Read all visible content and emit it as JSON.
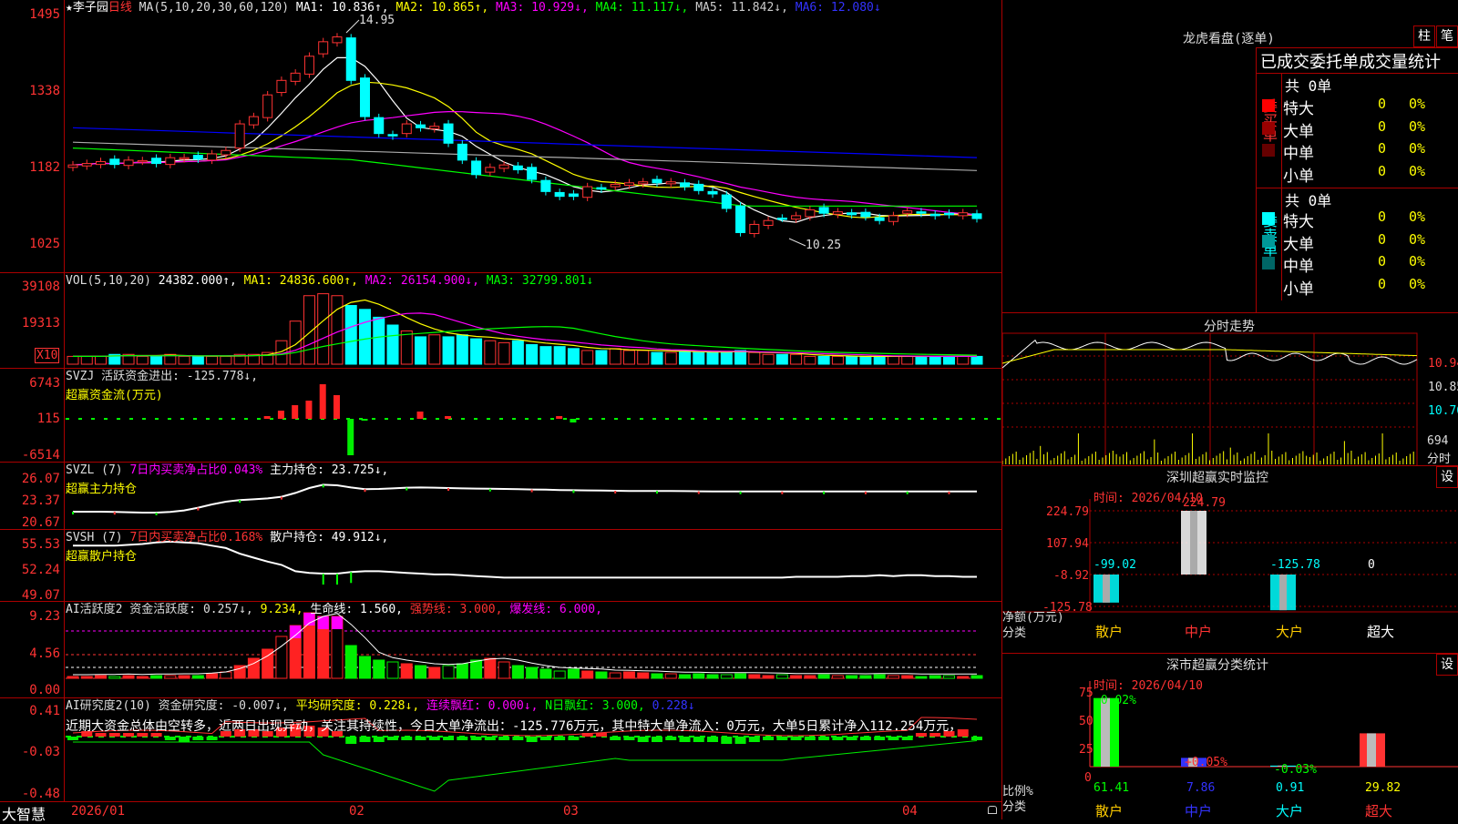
{
  "main": {
    "stock_name": "★李子园",
    "period": "日线",
    "ma_label": "MA(5,10,20,30,60,120)",
    "ma1": "MA1: 10.836↑,",
    "ma2": "MA2: 10.865↑,",
    "ma3": "MA3: 10.929↓,",
    "ma4": "MA4: 11.117↓,",
    "ma5": "MA5: 11.842↓,",
    "ma6": "MA6: 12.080↓",
    "y_ticks": [
      "1495",
      "1338",
      "1182",
      "1025"
    ],
    "high_label": "14.95",
    "low_label": "10.25",
    "colors": {
      "ma1": "#ffffff",
      "ma2": "#ffff00",
      "ma3": "#ff00ff",
      "ma4": "#00ff00",
      "ma5": "#9999ff",
      "ma6": "#0000ff",
      "up": "#ff3333",
      "down": "#00ffff"
    }
  },
  "vol": {
    "label": "VOL(5,10,20)",
    "value": "24382.000↑,",
    "ma1": "MA1: 24836.600↑,",
    "ma2": "MA2: 26154.900↓,",
    "ma3": "MA3: 32799.801↓",
    "y_ticks": [
      "39108",
      "19313"
    ],
    "unit": "X10"
  },
  "svzj": {
    "label": "SVZJ  活跃资金进出: -125.778↓,",
    "sub": "超赢资金流(万元)",
    "y_ticks": [
      "6743",
      "115",
      "-6514"
    ]
  },
  "svzl": {
    "label_a": "SVZL (7)",
    "label_b": "7日内买卖净占比0.043%",
    "label_c": "主力持仓: 23.725↓,",
    "sub": "超赢主力持仓",
    "y_ticks": [
      "26.07",
      "23.37",
      "20.67"
    ]
  },
  "svsh": {
    "label_a": "SVSH (7)",
    "label_b": "7日内买卖净占比0.168%",
    "label_c": "散户持仓: 49.912↓,",
    "sub": "超赢散户持仓",
    "y_ticks": [
      "55.53",
      "52.24",
      "49.07"
    ]
  },
  "ai2": {
    "label_a": "AI活跃度2 资金活跃度: 0.257↓,",
    "label_b": "9.234,",
    "label_c": "生命线: 1.560,",
    "label_d": "强势线: 3.000,",
    "label_e": "爆发线: 6.000,",
    "y_ticks": [
      "9.23",
      "4.56",
      "0.00"
    ]
  },
  "ai_research": {
    "label_a": "AI研究度2(10) 资金研究度: -0.007↓,",
    "label_b": "平均研究度: 0.228↓,",
    "label_c": "连续飘红: 0.000↓,",
    "label_d": "N日飘红: 3.000,",
    "label_e": "0.228↓",
    "comment": "近期大资金总体由空转多，近两日出现异动，关注其持续性，今日大单净流出：-125.776万元，其中特大单净流入：0万元，大单5日累计净入112.254万元，",
    "y_ticks": [
      "0.41",
      "-0.03",
      "-0.48"
    ]
  },
  "xaxis": {
    "brand": "大智慧",
    "labels": [
      "2026/01",
      "02",
      "03",
      "04"
    ]
  },
  "dragon": {
    "title": "龙虎看盘(逐单)",
    "btn_a": "柱",
    "btn_b": "笔",
    "subtitle": "已成交委托单成交量统计",
    "buy_side": "委买单",
    "sell_side": "委卖单",
    "buy_total": "共 0单",
    "sell_total": "共 0单",
    "buy_rows": [
      {
        "name": "特大",
        "count": "0",
        "pct": "0%",
        "color": "#ff0000"
      },
      {
        "name": "大单",
        "count": "0",
        "pct": "0%",
        "color": "#990000"
      },
      {
        "name": "中单",
        "count": "0",
        "pct": "0%",
        "color": "#660000"
      },
      {
        "name": "小单",
        "count": "0",
        "pct": "0%",
        "color": "#000000"
      }
    ],
    "sell_rows": [
      {
        "name": "特大",
        "count": "0",
        "pct": "0%",
        "color": "#00ffff"
      },
      {
        "name": "大单",
        "count": "0",
        "pct": "0%",
        "color": "#009999"
      },
      {
        "name": "中单",
        "count": "0",
        "pct": "0%",
        "color": "#006666"
      },
      {
        "name": "小单",
        "count": "0",
        "pct": "0%",
        "color": "#000000"
      }
    ]
  },
  "intraday": {
    "title": "分时走势",
    "y_ticks": [
      "10.94",
      "10.85",
      "10.76"
    ],
    "vol_label": "694",
    "unit_label": "分时"
  },
  "sz_monitor": {
    "title": "深圳超赢实时监控",
    "btn": "设",
    "time": "时间: 2026/04/10",
    "y_ticks": [
      "224.79",
      "107.94",
      "-8.92",
      "-125.78"
    ],
    "y_label": "净额(万元)",
    "x_label": "分类",
    "categories": [
      "散户",
      "中户",
      "大户",
      "超大"
    ],
    "values": [
      "-99.02",
      "224.79",
      "-125.78",
      "0"
    ]
  },
  "sz_class": {
    "title": "深市超赢分类统计",
    "btn": "设",
    "time": "时间: 2026/04/10",
    "y_ticks": [
      "75",
      "50",
      "25",
      "0"
    ],
    "y_label": "比例%",
    "x_label": "分类",
    "categories": [
      "散户",
      "中户",
      "大户",
      "超大"
    ],
    "top_labels": [
      "-0.02%",
      "+0.05%",
      "-0.03%",
      ""
    ],
    "values": [
      "61.41",
      "7.86",
      "0.91",
      "29.82"
    ]
  }
}
